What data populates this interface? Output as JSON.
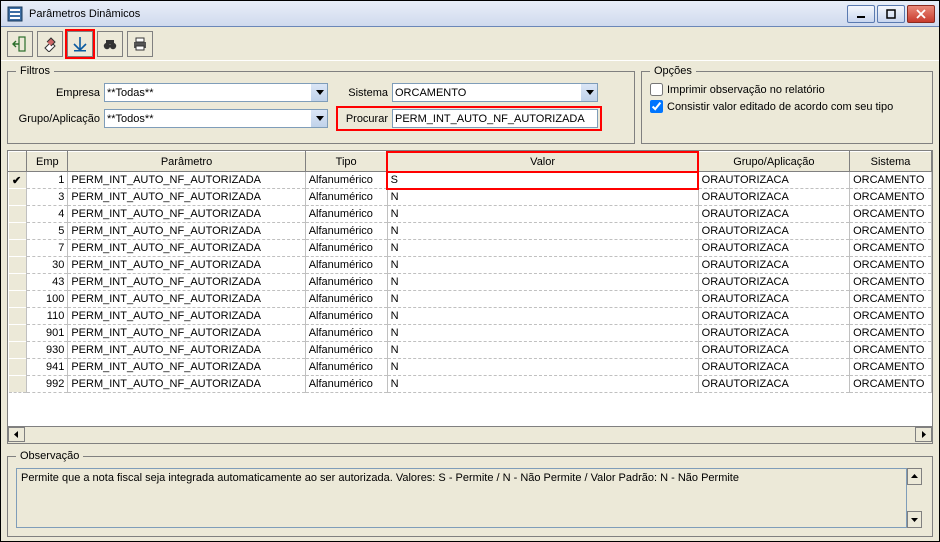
{
  "window": {
    "title": "Parâmetros Dinâmicos"
  },
  "toolbar": {
    "exit": "exit",
    "clear": "clear",
    "save": "save",
    "find": "find",
    "print": "print"
  },
  "filtros": {
    "legend": "Filtros",
    "empresa_label": "Empresa",
    "empresa_value": "**Todas**",
    "sistema_label": "Sistema",
    "sistema_value": "ORCAMENTO",
    "grupo_label": "Grupo/Aplicação",
    "grupo_value": "**Todos**",
    "procurar_label": "Procurar",
    "procurar_value": "PERM_INT_AUTO_NF_AUTORIZADA"
  },
  "opcoes": {
    "legend": "Opções",
    "imprimir_label": "Imprimir observação no relatório",
    "imprimir_checked": false,
    "consistir_label": "Consistir valor editado de acordo com seu tipo",
    "consistir_checked": true
  },
  "grid": {
    "headers": {
      "emp": "Emp",
      "parametro": "Parâmetro",
      "tipo": "Tipo",
      "valor": "Valor",
      "grupo": "Grupo/Aplicação",
      "sistema": "Sistema"
    },
    "rows": [
      {
        "sel": true,
        "emp": "1",
        "parametro": "PERM_INT_AUTO_NF_AUTORIZADA",
        "tipo": "Alfanumérico",
        "valor": "S",
        "grupo": "ORAUTORIZACA",
        "sistema": "ORCAMENTO"
      },
      {
        "sel": false,
        "emp": "3",
        "parametro": "PERM_INT_AUTO_NF_AUTORIZADA",
        "tipo": "Alfanumérico",
        "valor": "N",
        "grupo": "ORAUTORIZACA",
        "sistema": "ORCAMENTO"
      },
      {
        "sel": false,
        "emp": "4",
        "parametro": "PERM_INT_AUTO_NF_AUTORIZADA",
        "tipo": "Alfanumérico",
        "valor": "N",
        "grupo": "ORAUTORIZACA",
        "sistema": "ORCAMENTO"
      },
      {
        "sel": false,
        "emp": "5",
        "parametro": "PERM_INT_AUTO_NF_AUTORIZADA",
        "tipo": "Alfanumérico",
        "valor": "N",
        "grupo": "ORAUTORIZACA",
        "sistema": "ORCAMENTO"
      },
      {
        "sel": false,
        "emp": "7",
        "parametro": "PERM_INT_AUTO_NF_AUTORIZADA",
        "tipo": "Alfanumérico",
        "valor": "N",
        "grupo": "ORAUTORIZACA",
        "sistema": "ORCAMENTO"
      },
      {
        "sel": false,
        "emp": "30",
        "parametro": "PERM_INT_AUTO_NF_AUTORIZADA",
        "tipo": "Alfanumérico",
        "valor": "N",
        "grupo": "ORAUTORIZACA",
        "sistema": "ORCAMENTO"
      },
      {
        "sel": false,
        "emp": "43",
        "parametro": "PERM_INT_AUTO_NF_AUTORIZADA",
        "tipo": "Alfanumérico",
        "valor": "N",
        "grupo": "ORAUTORIZACA",
        "sistema": "ORCAMENTO"
      },
      {
        "sel": false,
        "emp": "100",
        "parametro": "PERM_INT_AUTO_NF_AUTORIZADA",
        "tipo": "Alfanumérico",
        "valor": "N",
        "grupo": "ORAUTORIZACA",
        "sistema": "ORCAMENTO"
      },
      {
        "sel": false,
        "emp": "110",
        "parametro": "PERM_INT_AUTO_NF_AUTORIZADA",
        "tipo": "Alfanumérico",
        "valor": "N",
        "grupo": "ORAUTORIZACA",
        "sistema": "ORCAMENTO"
      },
      {
        "sel": false,
        "emp": "901",
        "parametro": "PERM_INT_AUTO_NF_AUTORIZADA",
        "tipo": "Alfanumérico",
        "valor": "N",
        "grupo": "ORAUTORIZACA",
        "sistema": "ORCAMENTO"
      },
      {
        "sel": false,
        "emp": "930",
        "parametro": "PERM_INT_AUTO_NF_AUTORIZADA",
        "tipo": "Alfanumérico",
        "valor": "N",
        "grupo": "ORAUTORIZACA",
        "sistema": "ORCAMENTO"
      },
      {
        "sel": false,
        "emp": "941",
        "parametro": "PERM_INT_AUTO_NF_AUTORIZADA",
        "tipo": "Alfanumérico",
        "valor": "N",
        "grupo": "ORAUTORIZACA",
        "sistema": "ORCAMENTO"
      },
      {
        "sel": false,
        "emp": "992",
        "parametro": "PERM_INT_AUTO_NF_AUTORIZADA",
        "tipo": "Alfanumérico",
        "valor": "N",
        "grupo": "ORAUTORIZACA",
        "sistema": "ORCAMENTO"
      }
    ]
  },
  "observacao": {
    "legend": "Observação",
    "text": "Permite que a nota fiscal seja integrada automaticamente ao ser autorizada. Valores: S - Permite / N - Não Permite / Valor Padrão: N - Não Permite"
  }
}
